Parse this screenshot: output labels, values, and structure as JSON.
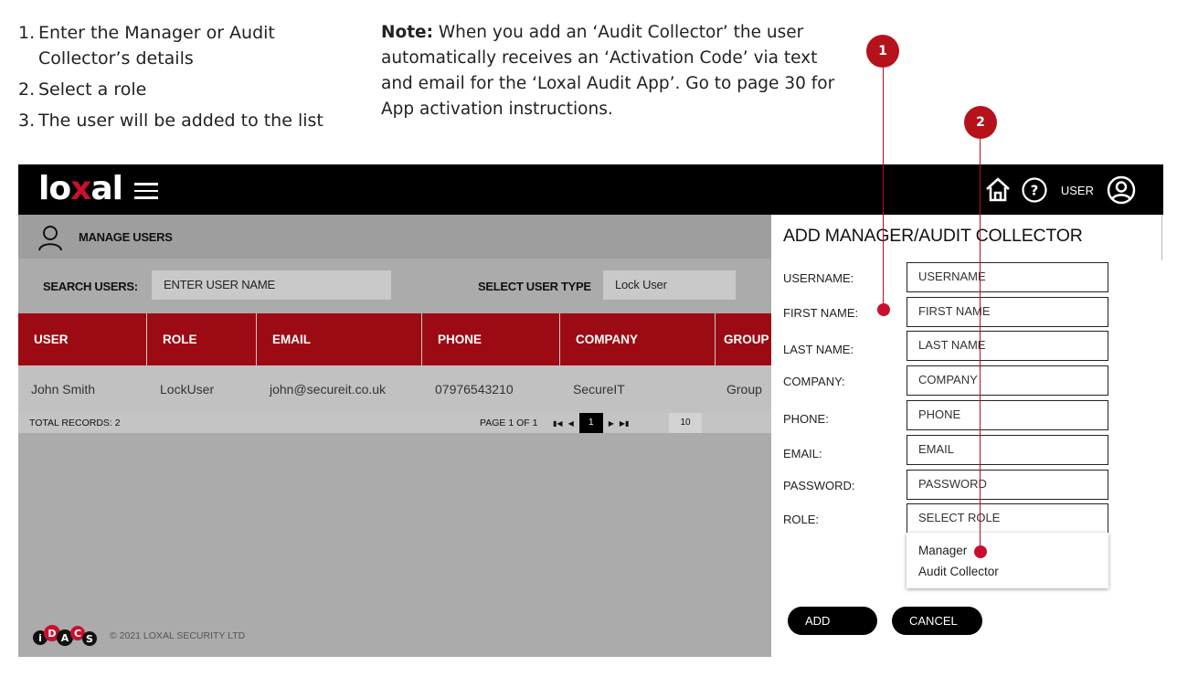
{
  "instructions": {
    "steps": [
      {
        "num": "1.",
        "text": "Enter the Manager or Audit Collector’s details"
      },
      {
        "num": "2.",
        "text": "Select a role"
      },
      {
        "num": "3.",
        "text": "The user will be added to the list"
      }
    ],
    "note_label": "Note:",
    "note_text": " When you add an ‘Audit Collector’ the user automatically receives an ‘Activation Code’ via text and email for the ‘Loxal Audit App’. Go to page 30 for App activation instructions."
  },
  "callouts": {
    "one": "1",
    "two": "2"
  },
  "colors": {
    "brand_red": "#9c0b13",
    "callout_red": "#b5121b",
    "topbar": "#000000"
  },
  "topbar": {
    "logo_part1": "lo",
    "logo_x": "x",
    "logo_part2": "al",
    "user_label": "USER",
    "icons": [
      "menu-icon",
      "home-icon",
      "help-icon",
      "user-circle-icon"
    ]
  },
  "subbar": {
    "title": "MANAGE USERS"
  },
  "search": {
    "search_label": "SEARCH USERS:",
    "search_placeholder": "ENTER USER NAME",
    "type_label": "SELECT USER TYPE",
    "type_value": "Lock User"
  },
  "table": {
    "columns": [
      "USER",
      "ROLE",
      "EMAIL",
      "PHONE",
      "COMPANY",
      "GROUP"
    ],
    "rows": [
      [
        "John Smith",
        "LockUser",
        "john@secureit.co.uk",
        "07976543210",
        "SecureIT",
        "Group"
      ]
    ],
    "total_records": "TOTAL RECORDS: 2",
    "page_info": "PAGE 1 OF 1",
    "current_page": "1",
    "per_page": "10"
  },
  "footer": {
    "brand_letters": [
      "i",
      "D",
      "A",
      "C",
      "S"
    ],
    "copyright": "© 2021 LOXAL SECURITY LTD"
  },
  "panel": {
    "title": "ADD MANAGER/AUDIT COLLECTOR",
    "fields": [
      {
        "label": "USERNAME:",
        "placeholder": "USERNAME"
      },
      {
        "label": "FIRST NAME:",
        "placeholder": "FIRST NAME"
      },
      {
        "label": "LAST NAME:",
        "placeholder": "LAST NAME"
      },
      {
        "label": "COMPANY:",
        "placeholder": "COMPANY"
      },
      {
        "label": "PHONE:",
        "placeholder": "PHONE"
      },
      {
        "label": "EMAIL:",
        "placeholder": "EMAIL"
      },
      {
        "label": "PASSWORD:",
        "placeholder": "PASSWORD"
      },
      {
        "label": "ROLE:",
        "placeholder": "SELECT ROLE"
      }
    ],
    "role_options": [
      "Manager",
      "Audit Collector"
    ],
    "add_label": "ADD",
    "cancel_label": "CANCEL"
  }
}
